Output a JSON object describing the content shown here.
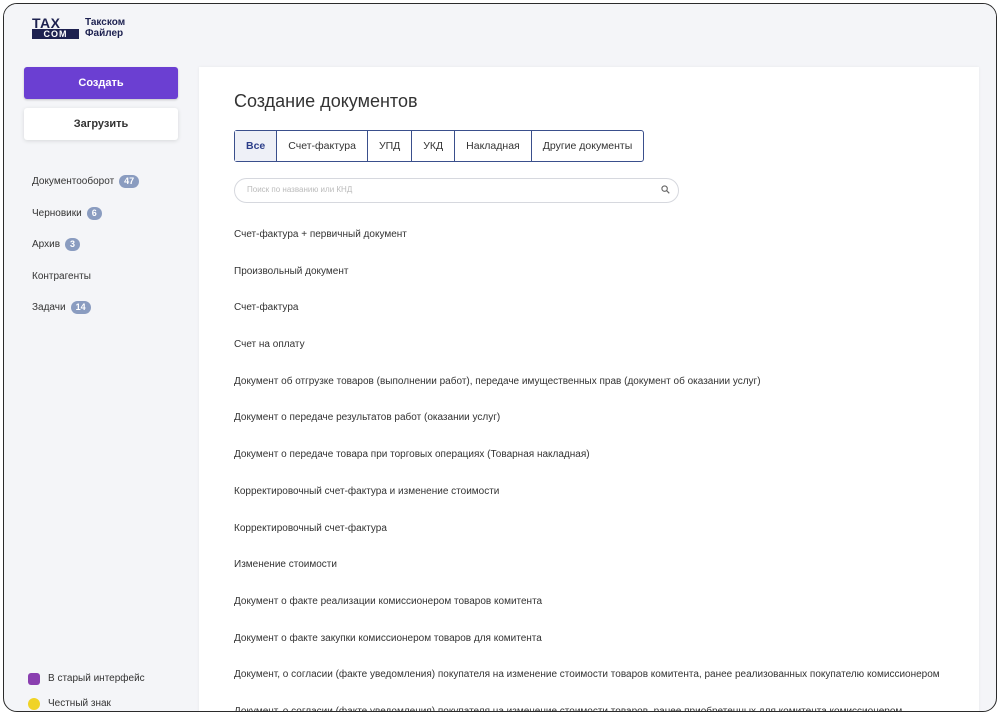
{
  "app": {
    "logo_tax": "TAX",
    "logo_com": "COM",
    "logo_line1": "Такском",
    "logo_line2": "Файлер"
  },
  "sidebar": {
    "create_label": "Создать",
    "upload_label": "Загрузить",
    "items": [
      {
        "label": "Документооборот",
        "badge": "47"
      },
      {
        "label": "Черновики",
        "badge": "6"
      },
      {
        "label": "Архив",
        "badge": "3"
      },
      {
        "label": "Контрагенты",
        "badge": ""
      },
      {
        "label": "Задачи",
        "badge": "14"
      }
    ],
    "bottom": [
      {
        "label": "В старый интерфейс",
        "icon": "old-interface-icon"
      },
      {
        "label": "Честный знак",
        "icon": "chestny-znak-icon"
      }
    ]
  },
  "main": {
    "title": "Создание документов",
    "tabs": [
      {
        "label": "Все",
        "active": true
      },
      {
        "label": "Счет-фактура",
        "active": false
      },
      {
        "label": "УПД",
        "active": false
      },
      {
        "label": "УКД",
        "active": false
      },
      {
        "label": "Накладная",
        "active": false
      },
      {
        "label": "Другие документы",
        "active": false
      }
    ],
    "search": {
      "placeholder": "Поиск по названию или КНД",
      "value": ""
    },
    "documents": [
      "Счет-фактура + первичный документ",
      "Произвольный документ",
      "Счет-фактура",
      "Счет на оплату",
      "Документ об отгрузке товаров (выполнении работ), передаче имущественных прав (документ об оказании услуг)",
      "Документ о передаче результатов работ (оказании услуг)",
      "Документ о передаче товара при торговых операциях (Товарная накладная)",
      "Корректировочный счет-фактура и изменение стоимости",
      "Корректировочный счет-фактура",
      "Изменение стоимости",
      "Документ о факте реализации комиссионером товаров комитента",
      "Документ о факте закупки комиссионером товаров для комитента",
      "Документ, о согласии (факте уведомления) покупателя на изменение стоимости товаров комитента, ранее реализованных покупателю комиссионером",
      "Документ, о согласии (факте уведомления) покупателя на изменение стоимости товаров, ранее приобретенных для комитента комиссионером"
    ]
  },
  "colors": {
    "accent": "#6b3fd2",
    "badge": "#8a9cc0",
    "tab_border": "#3a4f8c"
  }
}
